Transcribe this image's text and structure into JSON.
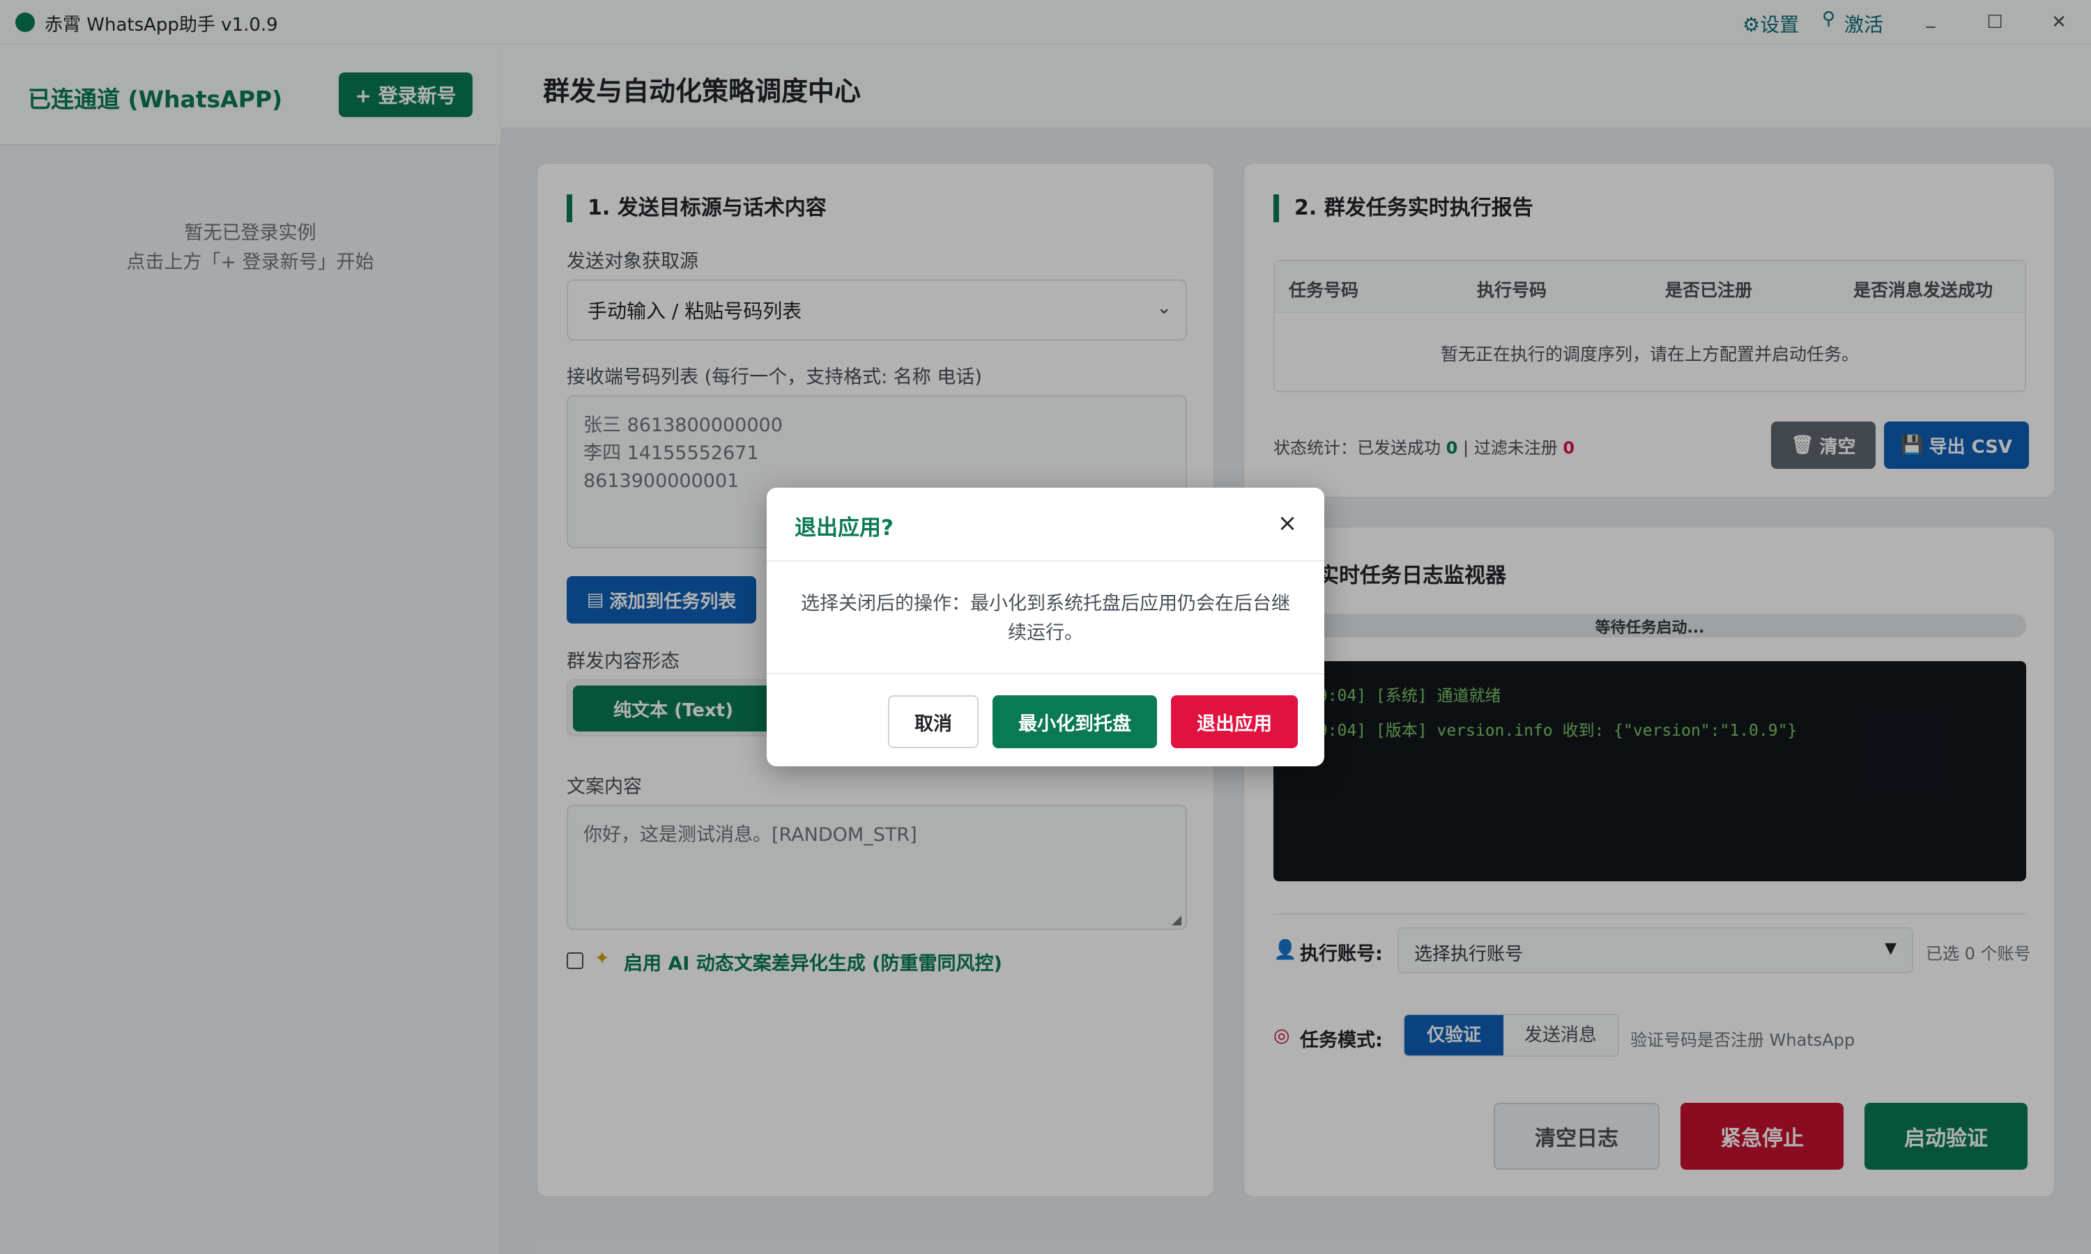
{
  "window": {
    "title": "赤霄 WhatsApp助手 v1.0.9",
    "settings_label": "⚙设置",
    "activate_label": "激活",
    "minimize_glyph": "_",
    "maximize_glyph": "☐",
    "close_glyph": "✕"
  },
  "sidebar": {
    "title": "已连通道 (WhatsAPP)",
    "login_button": "+ 登录新号",
    "empty_line1": "暂无已登录实例",
    "empty_line2": "点击上方「+ 登录新号」开始"
  },
  "main": {
    "title": "群发与自动化策略调度中心"
  },
  "panel1": {
    "title": "1. 发送目标源与话术内容",
    "source_label": "发送对象获取源",
    "source_value": "手动输入 / 粘贴号码列表",
    "numbers_label": "接收端号码列表 (每行一个，支持格式: 名称 电话)",
    "numbers_placeholder": [
      "张三 8613800000000",
      "李四 14155552671",
      "8613900000001"
    ],
    "add_button": "添加到任务列表",
    "content_type_label": "群发内容形态",
    "content_type_selected": "纯文本 (Text)",
    "copy_label": "文案内容",
    "copy_placeholder": "你好，这是测试消息。[RANDOM_STR]",
    "ai_checkbox_label": "启用 AI 动态文案差异化生成 (防重雷同风控)",
    "ai_checked": false
  },
  "panel2": {
    "title": "2. 群发任务实时执行报告",
    "columns": [
      "任务号码",
      "执行号码",
      "是否已注册",
      "是否消息发送成功"
    ],
    "empty_text": "暂无正在执行的调度序列，请在上方配置并启动任务。",
    "stats_prefix": "状态统计：已发送成功",
    "stats_success": "0",
    "stats_sep": "| 过滤未注册",
    "stats_filtered": "0",
    "clear_button": "清空",
    "export_button": "导出 CSV"
  },
  "panel3": {
    "title_visible": "实时任务日志监视器",
    "progress_text": "等待任务启动...",
    "log_lines": [
      "19:04] [系统] 通道就绪",
      "19:04] [版本] version.info 收到: {\"version\":\"1.0.9\"}"
    ],
    "account_label": "执行账号:",
    "account_placeholder": "选择执行账号",
    "account_count": "已选 0 个账号",
    "mode_label": "任务模式:",
    "mode_options": [
      "仅验证",
      "发送消息"
    ],
    "mode_selected": "仅验证",
    "mode_hint": "验证号码是否注册 WhatsApp",
    "clear_log_button": "清空日志",
    "stop_button": "紧急停止",
    "start_button": "启动验证"
  },
  "modal": {
    "title": "退出应用?",
    "close_glyph": "×",
    "body": "选择关闭后的操作：最小化到系统托盘后应用仍会在后台继续运行。",
    "cancel_button": "取消",
    "minimize_button": "最小化到托盘",
    "exit_button": "退出应用"
  },
  "colors": {
    "primary_green": "#0a7a55",
    "primary_blue": "#0d5fb5",
    "danger_red": "#e0123f",
    "stop_red": "#c8102e",
    "gray_button": "#5f6670",
    "log_bg": "#13171c"
  }
}
